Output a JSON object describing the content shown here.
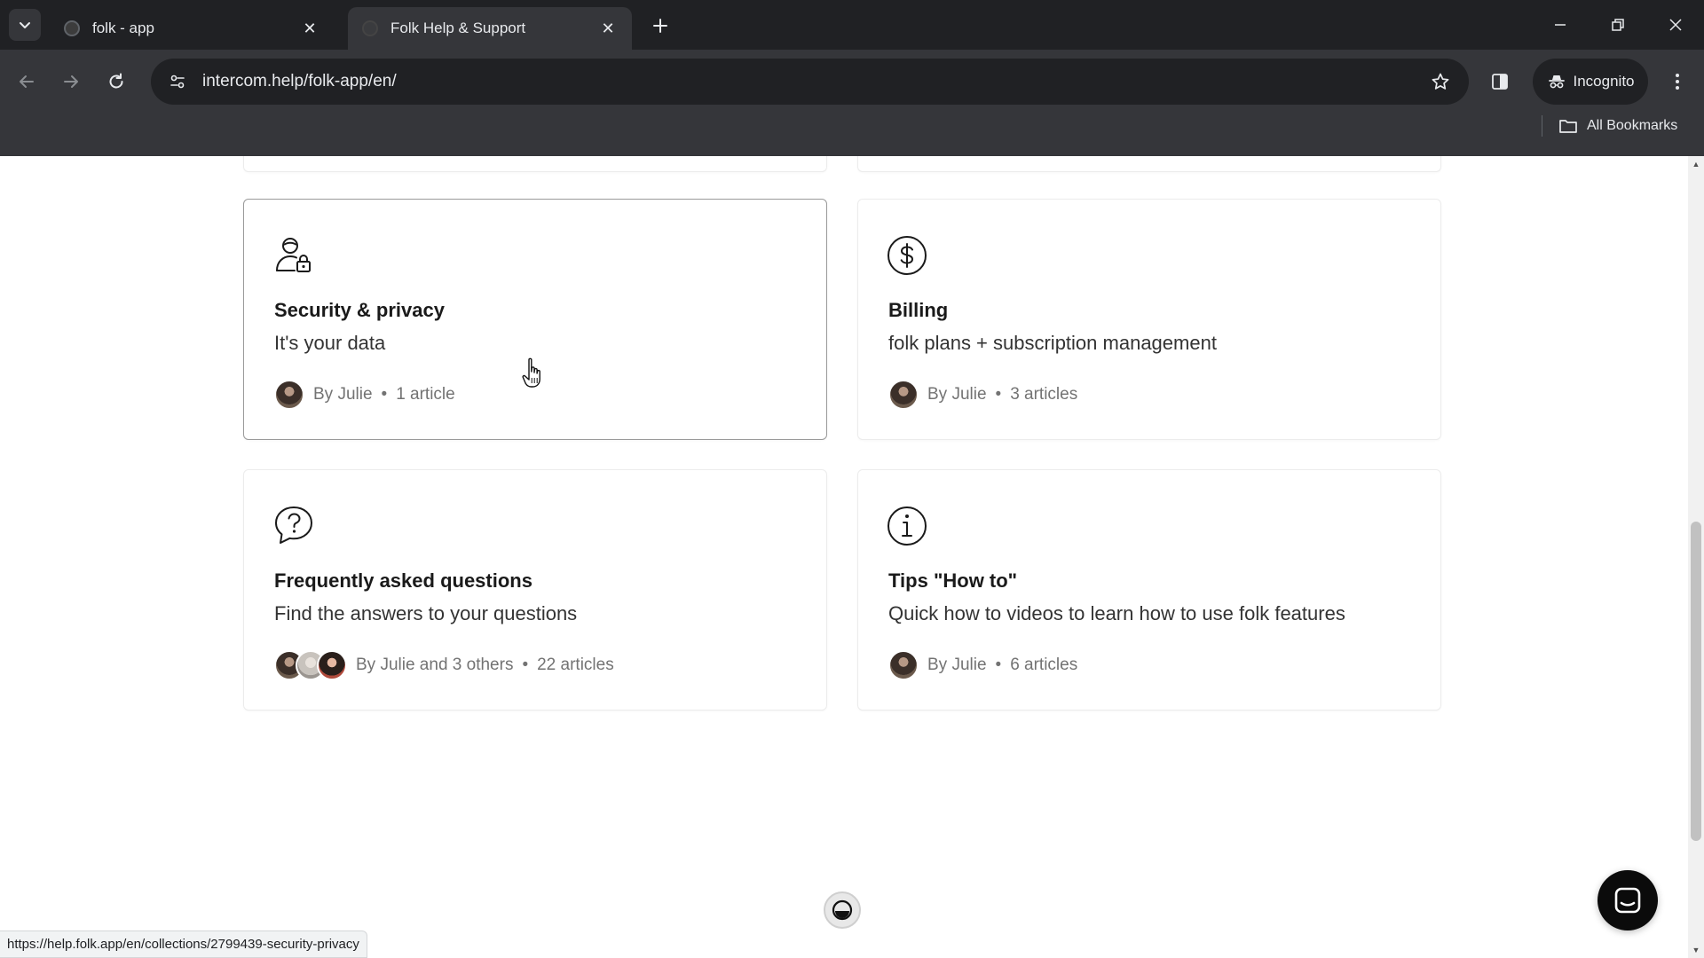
{
  "browser": {
    "tabs": [
      {
        "title": "folk - app",
        "active": false
      },
      {
        "title": "Folk Help & Support",
        "active": true
      }
    ],
    "url": "intercom.help/folk-app/en/",
    "incognito_label": "Incognito",
    "bookmarks_label": "All Bookmarks",
    "status_url": "https://help.folk.app/en/collections/2799439-security-privacy"
  },
  "collections": [
    {
      "icon": "user-lock-icon",
      "title": "Security & privacy",
      "description": "It's your data",
      "author": "By Julie",
      "separator": "•",
      "count": "1 article",
      "hovered": true
    },
    {
      "icon": "dollar-circle-icon",
      "title": "Billing",
      "description": "folk plans + subscription management",
      "author": "By Julie",
      "separator": "•",
      "count": "3 articles",
      "hovered": false
    },
    {
      "icon": "question-bubble-icon",
      "title": "Frequently asked questions",
      "description": "Find the answers to your questions",
      "author": "By Julie and 3 others",
      "separator": "•",
      "count": "22 articles",
      "hovered": false
    },
    {
      "icon": "info-circle-icon",
      "title": "Tips \"How to\"",
      "description": "Quick how to videos to learn how to use folk features",
      "author": "By Julie",
      "separator": "•",
      "count": "6 articles",
      "hovered": false
    }
  ],
  "colors": {
    "chrome_dark": "#202124",
    "chrome_toolbar": "#35363a",
    "launcher": "#0b0b0b"
  }
}
